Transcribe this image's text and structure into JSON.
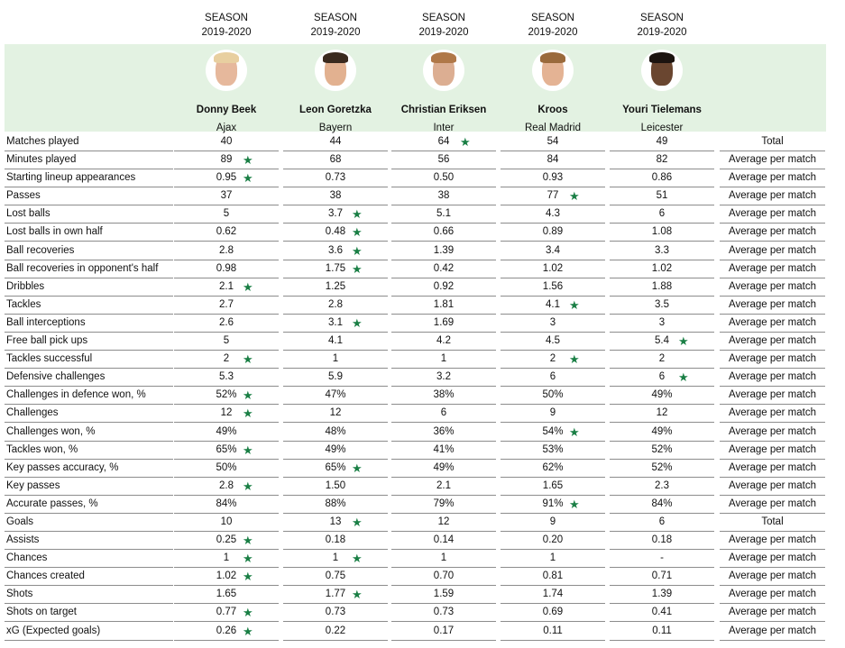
{
  "colors": {
    "header_band": "#e3f2e2",
    "star": "#1a7f45",
    "divider": "#8c8c8c"
  },
  "players": [
    {
      "season_label": "SEASON",
      "season": "2019-2020",
      "name": "Donny Beek",
      "club": "Ajax",
      "avatar_icon": "player-photo"
    },
    {
      "season_label": "SEASON",
      "season": "2019-2020",
      "name": "Leon Goretzka",
      "club": "Bayern",
      "avatar_icon": "player-photo"
    },
    {
      "season_label": "SEASON",
      "season": "2019-2020",
      "name": "Christian Eriksen",
      "club": "Inter",
      "avatar_icon": "player-photo"
    },
    {
      "season_label": "SEASON",
      "season": "2019-2020",
      "name": "Kroos",
      "club": "Real Madrid",
      "avatar_icon": "player-photo"
    },
    {
      "season_label": "SEASON",
      "season": "2019-2020",
      "name": "Youri Tielemans",
      "club": "Leicester",
      "avatar_icon": "player-photo"
    }
  ],
  "star_icon": "★",
  "rows": [
    {
      "label": "Matches played",
      "values": [
        "40",
        "44",
        "64",
        "54",
        "49"
      ],
      "stars": [
        false,
        false,
        true,
        false,
        false
      ],
      "type": "Total"
    },
    {
      "label": "Minutes played",
      "values": [
        "89",
        "68",
        "56",
        "84",
        "82"
      ],
      "stars": [
        true,
        false,
        false,
        false,
        false
      ],
      "type": "Average per match"
    },
    {
      "label": "Starting lineup appearances",
      "values": [
        "0.95",
        "0.73",
        "0.50",
        "0.93",
        "0.86"
      ],
      "stars": [
        true,
        false,
        false,
        false,
        false
      ],
      "type": "Average per match"
    },
    {
      "label": "Passes",
      "values": [
        "37",
        "38",
        "38",
        "77",
        "51"
      ],
      "stars": [
        false,
        false,
        false,
        true,
        false
      ],
      "type": "Average per match"
    },
    {
      "label": "Lost balls",
      "values": [
        "5",
        "3.7",
        "5.1",
        "4.3",
        "6"
      ],
      "stars": [
        false,
        true,
        false,
        false,
        false
      ],
      "type": "Average per match"
    },
    {
      "label": "Lost balls in own half",
      "values": [
        "0.62",
        "0.48",
        "0.66",
        "0.89",
        "1.08"
      ],
      "stars": [
        false,
        true,
        false,
        false,
        false
      ],
      "type": "Average per match"
    },
    {
      "label": "Ball recoveries",
      "values": [
        "2.8",
        "3.6",
        "1.39",
        "3.4",
        "3.3"
      ],
      "stars": [
        false,
        true,
        false,
        false,
        false
      ],
      "type": "Average per match"
    },
    {
      "label": "Ball recoveries in opponent's half",
      "values": [
        "0.98",
        "1.75",
        "0.42",
        "1.02",
        "1.02"
      ],
      "stars": [
        false,
        true,
        false,
        false,
        false
      ],
      "type": "Average per match"
    },
    {
      "label": "Dribbles",
      "values": [
        "2.1",
        "1.25",
        "0.92",
        "1.56",
        "1.88"
      ],
      "stars": [
        true,
        false,
        false,
        false,
        false
      ],
      "type": "Average per match"
    },
    {
      "label": "Tackles",
      "values": [
        "2.7",
        "2.8",
        "1.81",
        "4.1",
        "3.5"
      ],
      "stars": [
        false,
        false,
        false,
        true,
        false
      ],
      "type": "Average per match"
    },
    {
      "label": "Ball interceptions",
      "values": [
        "2.6",
        "3.1",
        "1.69",
        "3",
        "3"
      ],
      "stars": [
        false,
        true,
        false,
        false,
        false
      ],
      "type": "Average per match"
    },
    {
      "label": "Free ball pick ups",
      "values": [
        "5",
        "4.1",
        "4.2",
        "4.5",
        "5.4"
      ],
      "stars": [
        false,
        false,
        false,
        false,
        true
      ],
      "type": "Average per match"
    },
    {
      "label": "Tackles successful",
      "values": [
        "2",
        "1",
        "1",
        "2",
        "2"
      ],
      "stars": [
        true,
        false,
        false,
        true,
        false
      ],
      "type": "Average per match"
    },
    {
      "label": "Defensive challenges",
      "values": [
        "5.3",
        "5.9",
        "3.2",
        "6",
        "6"
      ],
      "stars": [
        false,
        false,
        false,
        false,
        true
      ],
      "type": "Average per match"
    },
    {
      "label": "Challenges in defence won, %",
      "values": [
        "52%",
        "47%",
        "38%",
        "50%",
        "49%"
      ],
      "stars": [
        true,
        false,
        false,
        false,
        false
      ],
      "type": "Average per match"
    },
    {
      "label": "Challenges",
      "values": [
        "12",
        "12",
        "6",
        "9",
        "12"
      ],
      "stars": [
        true,
        false,
        false,
        false,
        false
      ],
      "type": "Average per match"
    },
    {
      "label": "Challenges won, %",
      "values": [
        "49%",
        "48%",
        "36%",
        "54%",
        "49%"
      ],
      "stars": [
        false,
        false,
        false,
        true,
        false
      ],
      "type": "Average per match"
    },
    {
      "label": "Tackles won, %",
      "values": [
        "65%",
        "49%",
        "41%",
        "53%",
        "52%"
      ],
      "stars": [
        true,
        false,
        false,
        false,
        false
      ],
      "type": "Average per match"
    },
    {
      "label": "Key passes accuracy, %",
      "values": [
        "50%",
        "65%",
        "49%",
        "62%",
        "52%"
      ],
      "stars": [
        false,
        true,
        false,
        false,
        false
      ],
      "type": "Average per match"
    },
    {
      "label": "Key passes",
      "values": [
        "2.8",
        "1.50",
        "2.1",
        "1.65",
        "2.3"
      ],
      "stars": [
        true,
        false,
        false,
        false,
        false
      ],
      "type": "Average per match"
    },
    {
      "label": "Accurate passes, %",
      "values": [
        "84%",
        "88%",
        "79%",
        "91%",
        "84%"
      ],
      "stars": [
        false,
        false,
        false,
        true,
        false
      ],
      "type": "Average per match"
    },
    {
      "label": "Goals",
      "values": [
        "10",
        "13",
        "12",
        "9",
        "6"
      ],
      "stars": [
        false,
        true,
        false,
        false,
        false
      ],
      "type": "Total"
    },
    {
      "label": "Assists",
      "values": [
        "0.25",
        "0.18",
        "0.14",
        "0.20",
        "0.18"
      ],
      "stars": [
        true,
        false,
        false,
        false,
        false
      ],
      "type": "Average per match"
    },
    {
      "label": "Chances",
      "values": [
        "1",
        "1",
        "1",
        "1",
        "-"
      ],
      "stars": [
        true,
        true,
        false,
        false,
        false
      ],
      "type": "Average per match"
    },
    {
      "label": "Chances created",
      "values": [
        "1.02",
        "0.75",
        "0.70",
        "0.81",
        "0.71"
      ],
      "stars": [
        true,
        false,
        false,
        false,
        false
      ],
      "type": "Average per match"
    },
    {
      "label": "Shots",
      "values": [
        "1.65",
        "1.77",
        "1.59",
        "1.74",
        "1.39"
      ],
      "stars": [
        false,
        true,
        false,
        false,
        false
      ],
      "type": "Average per match"
    },
    {
      "label": "Shots on target",
      "values": [
        "0.77",
        "0.73",
        "0.73",
        "0.69",
        "0.41"
      ],
      "stars": [
        true,
        false,
        false,
        false,
        false
      ],
      "type": "Average per match"
    },
    {
      "label": "xG (Expected goals)",
      "values": [
        "0.26",
        "0.22",
        "0.17",
        "0.11",
        "0.11"
      ],
      "stars": [
        true,
        false,
        false,
        false,
        false
      ],
      "type": "Average per match"
    }
  ]
}
